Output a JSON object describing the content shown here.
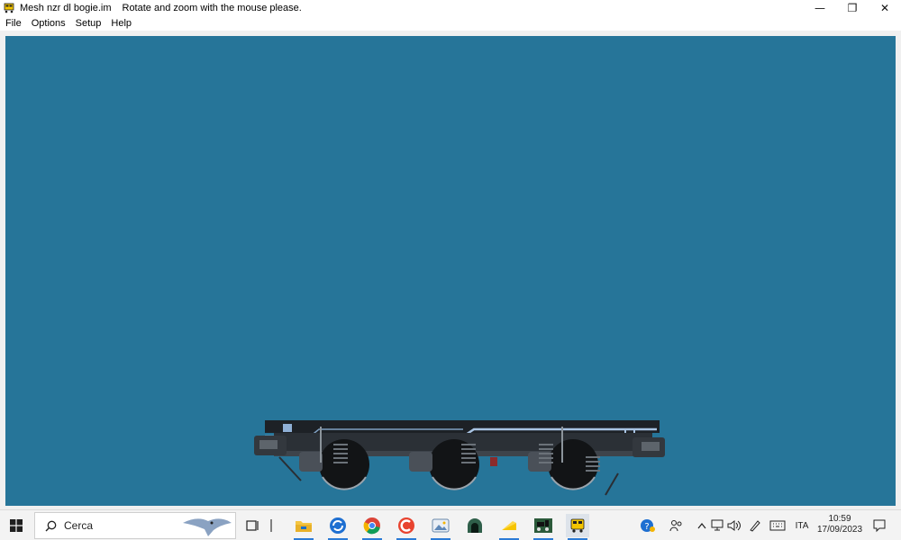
{
  "window": {
    "app_name": "Mesh nzr dl bogie.im",
    "message": "Rotate and zoom with the mouse please.",
    "controls": {
      "minimize": "—",
      "restore": "❐",
      "close": "✕"
    }
  },
  "menu": {
    "items": [
      "File",
      "Options",
      "Setup",
      "Help"
    ]
  },
  "viewport": {
    "background": "#267599",
    "model_name": "bogie"
  },
  "taskbar": {
    "search": {
      "placeholder": "Cerca"
    },
    "apps": [
      {
        "name": "task-view",
        "icon": "task-view-icon"
      },
      {
        "name": "file-explorer",
        "icon": "folder-icon"
      },
      {
        "name": "app-blue-circle",
        "icon": "sync-icon"
      },
      {
        "name": "chrome",
        "icon": "chrome-icon"
      },
      {
        "name": "app-red-c",
        "icon": "ccleaner-icon"
      },
      {
        "name": "photos",
        "icon": "photos-icon"
      },
      {
        "name": "app-tunnel",
        "icon": "tunnel-icon"
      },
      {
        "name": "app-cheese",
        "icon": "cheese-icon"
      },
      {
        "name": "app-train",
        "icon": "train-icon"
      },
      {
        "name": "app-bus",
        "icon": "bus-icon"
      }
    ],
    "tray": {
      "language": "ITA",
      "time": "10:59",
      "date": "17/09/2023"
    }
  },
  "colors": {
    "accent": "#2b7bd6",
    "viewport_bg": "#267599",
    "taskbar_bg": "#f3f3f3"
  }
}
